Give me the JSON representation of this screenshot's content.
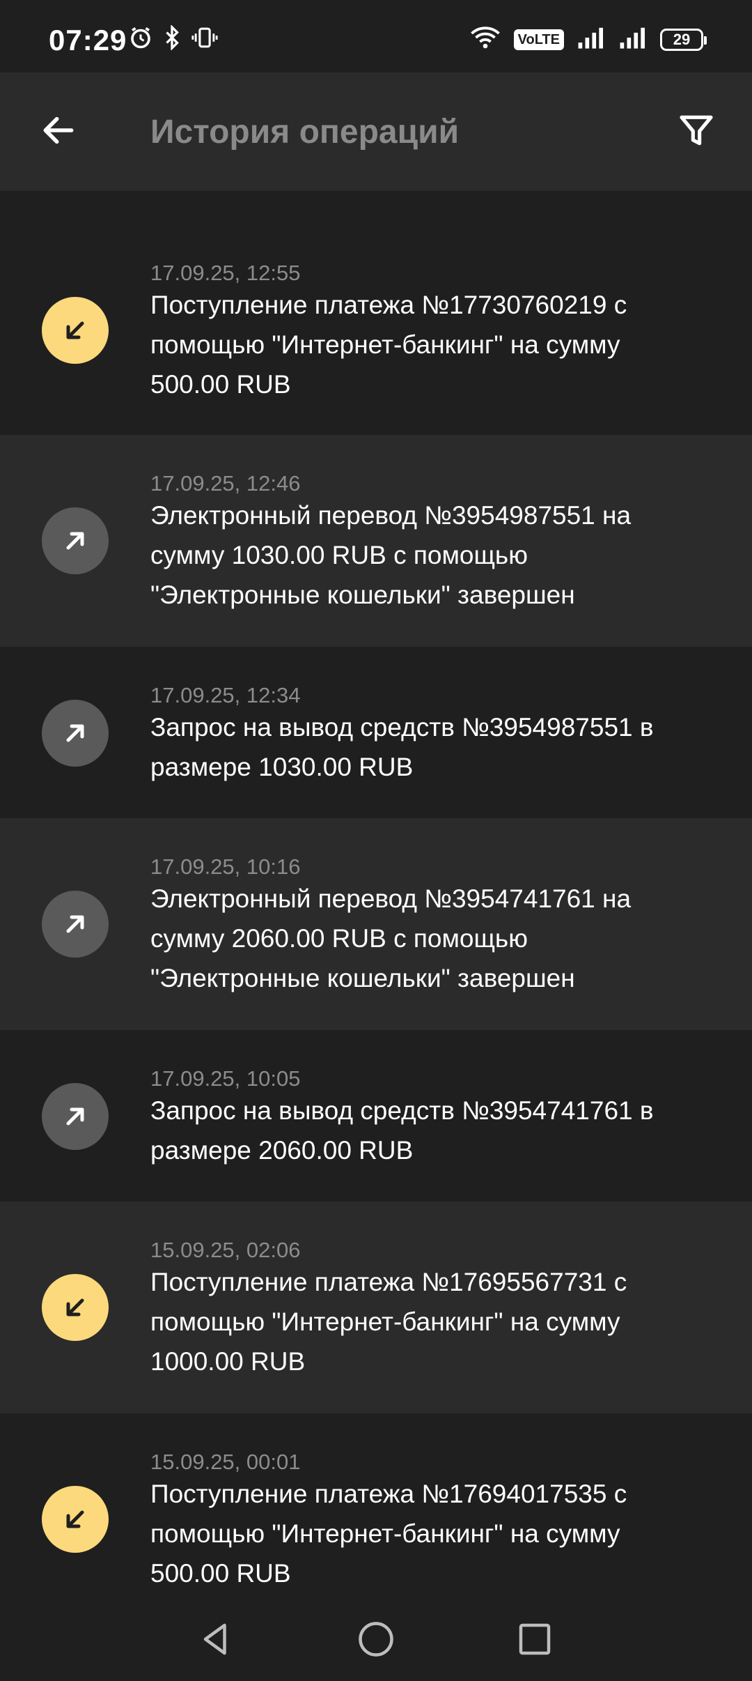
{
  "status_bar": {
    "time": "07:29",
    "volte": "VoLTE",
    "battery": "29",
    "icons": [
      "alarm-icon",
      "bluetooth-icon",
      "vibrate-icon",
      "wifi-icon",
      "signal-icon",
      "signal-icon"
    ]
  },
  "header": {
    "title": "История операций",
    "back_icon": "arrow-left-icon",
    "filter_icon": "filter-icon"
  },
  "operations": [
    {
      "direction": "in",
      "date": "17.09.25, 12:55",
      "text": "Поступление платежа №17730760219 с помощью \"Интернет-банкинг\" на сумму 500.00 RUB"
    },
    {
      "direction": "out",
      "date": "17.09.25, 12:46",
      "text": "Электронный перевод №3954987551 на сумму 1030.00 RUB с помощью \"Электронные кошельки\" завершен"
    },
    {
      "direction": "out",
      "date": "17.09.25, 12:34",
      "text": "Запрос на вывод средств №3954987551 в размере 1030.00 RUB"
    },
    {
      "direction": "out",
      "date": "17.09.25, 10:16",
      "text": "Электронный перевод №3954741761 на сумму 2060.00 RUB с помощью \"Электронные кошельки\" завершен"
    },
    {
      "direction": "out",
      "date": "17.09.25, 10:05",
      "text": "Запрос на вывод средств №3954741761 в размере 2060.00 RUB"
    },
    {
      "direction": "in",
      "date": "15.09.25, 02:06",
      "text": "Поступление платежа №17695567731 с помощью \"Интернет-банкинг\" на сумму 1000.00 RUB"
    },
    {
      "direction": "in",
      "date": "15.09.25, 00:01",
      "text": "Поступление платежа №17694017535 с помощью \"Интернет-банкинг\" на сумму 500.00 RUB"
    }
  ],
  "nav_bar": {
    "back_icon": "nav-back-icon",
    "home_icon": "nav-home-icon",
    "recents_icon": "nav-recents-icon"
  }
}
